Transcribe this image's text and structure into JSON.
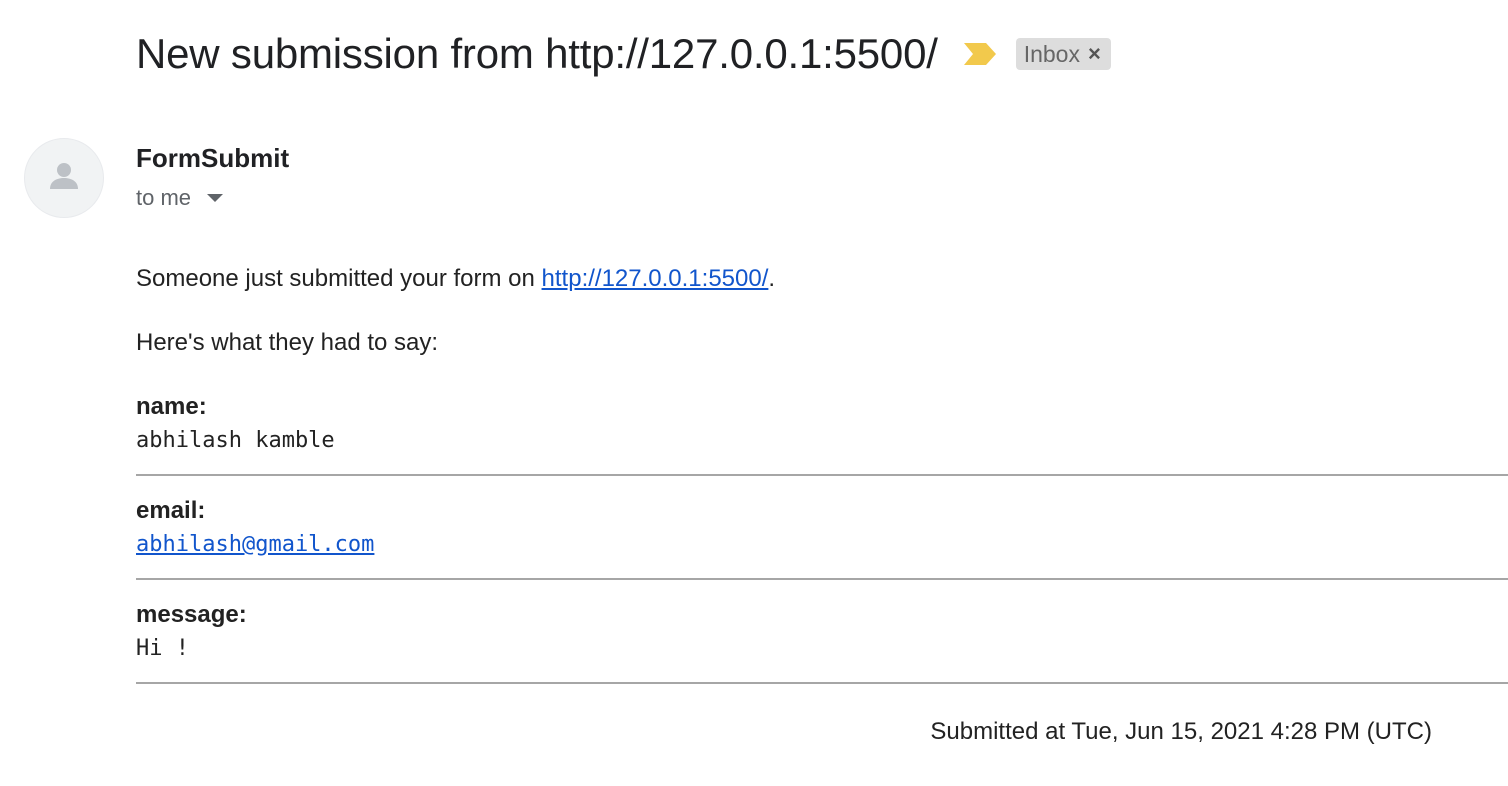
{
  "subject": "New submission from http://127.0.0.1:5500/",
  "importance_icon": "importance-marker-icon",
  "colors": {
    "importance_marker": "#f2c94c",
    "label_chip_bg": "#dddddd",
    "link": "#1155cc"
  },
  "label_chip": {
    "text": "Inbox",
    "remove": "×"
  },
  "sender": {
    "name": "FormSubmit",
    "recipient": "to me",
    "avatar_icon": "person-icon"
  },
  "body": {
    "intro_prefix": "Someone just submitted your form on ",
    "intro_link": "http://127.0.0.1:5500/",
    "intro_suffix": ".",
    "intro2": "Here's what they had to say:",
    "fields": [
      {
        "label": "name:",
        "value": "abhilash kamble"
      },
      {
        "label": "email:",
        "value": "abhilash@gmail.com"
      },
      {
        "label": "message:",
        "value": "Hi !"
      }
    ],
    "footer": "Submitted at Tue, Jun 15, 2021 4:28 PM (UTC)"
  }
}
